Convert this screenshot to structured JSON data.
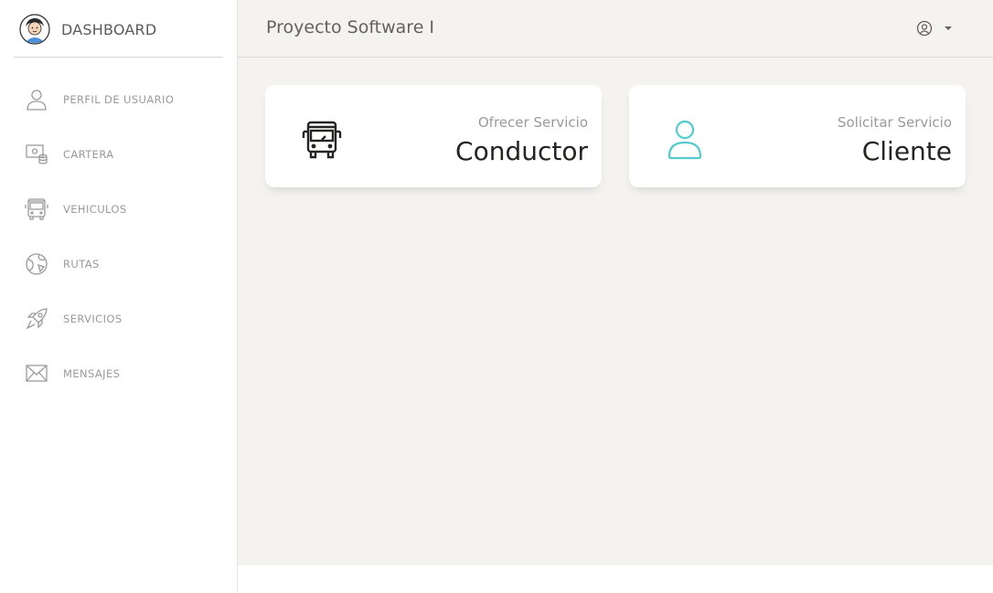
{
  "brand": {
    "text": "DASHBOARD"
  },
  "sidebar": {
    "items": [
      {
        "label": "PERFIL DE USUARIO",
        "icon": "user-icon"
      },
      {
        "label": "CARTERA",
        "icon": "wallet-icon"
      },
      {
        "label": "VEHICULOS",
        "icon": "bus-icon"
      },
      {
        "label": "RUTAS",
        "icon": "globe-icon"
      },
      {
        "label": "SERVICIOS",
        "icon": "rocket-icon"
      },
      {
        "label": "MENSAJES",
        "icon": "envelope-icon"
      }
    ]
  },
  "topbar": {
    "title": "Proyecto Software I"
  },
  "cards": [
    {
      "category": "Ofrecer Servicio",
      "title": "Conductor",
      "icon": "bus-icon",
      "icon_color": "#252422"
    },
    {
      "category": "Solicitar Servicio",
      "title": "Cliente",
      "icon": "user-icon",
      "icon_color": "#51cbce"
    }
  ],
  "colors": {
    "sidebar_text": "#9a9a9a",
    "main_bg": "#f4f3ef",
    "accent": "#51cbce"
  }
}
